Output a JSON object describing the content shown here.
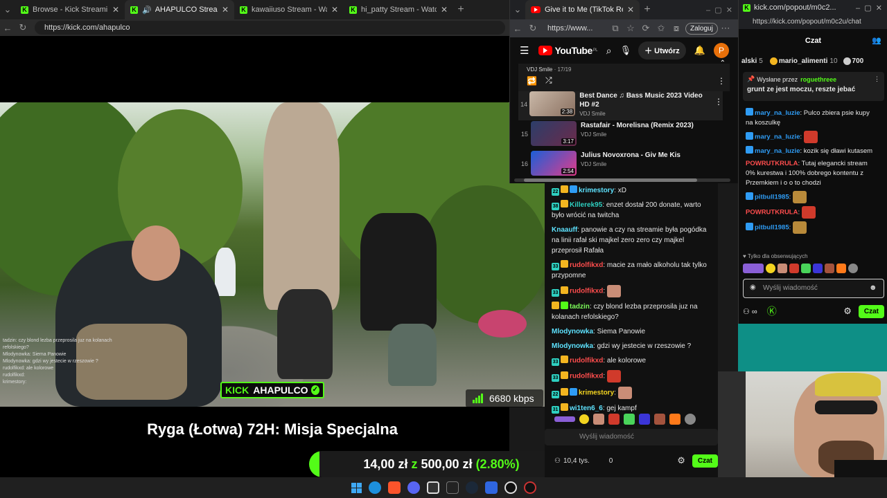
{
  "browser1": {
    "tabs": [
      {
        "label": "Browse - Kick Streaming",
        "active": false
      },
      {
        "label": "AHAPULCO Stream - Watch Li",
        "active": true
      },
      {
        "label": "kawaiiuso Stream - Watch Live on",
        "active": false
      },
      {
        "label": "hi_patty Stream - Watch Live on K",
        "active": false
      }
    ],
    "url": "https://kick.com/ahapulco"
  },
  "stream": {
    "logo_prefix": "KICK",
    "logo_name": "AHAPULCO",
    "bitrate": "6680 kbps",
    "title": "Ryga (Łotwa) 72H: Misja Specjalna",
    "goal_current": "14,00 zł",
    "goal_sep": "z",
    "goal_target": "500,00 zł",
    "goal_percent": "(2.80%)",
    "goal_fraction": 0.028,
    "overlay_chat": [
      "tadzin: czy blond lezba przeprosila juz na kolanach",
      "refolskiego?",
      "Mlodynowka: Siema Panowie",
      "Mlodynowka: gdzi wy jestecie w rzeszowie ?",
      "rudolfikxd: ale kolorowe",
      "rudolfikxd:",
      "krimestory:"
    ]
  },
  "kick_chat": {
    "messages": [
      {
        "badges": [
          "22",
          "crown",
          "mod"
        ],
        "user": "krimestory",
        "text": "xD",
        "color": "#5ee3ff"
      },
      {
        "badges": [
          "38",
          "crown"
        ],
        "user": "Killerek95",
        "text": "enzet dostał 200 donate, warto było wrócić na twitcha",
        "color": "#2ecfc0"
      },
      {
        "badges": [],
        "user": "Knaauff",
        "text": "panowie a czy na streamie była pogódka na linii rafał ski majkel zero zero czy majkel przeprosił Rafała",
        "color": "#5ee3ff"
      },
      {
        "badges": [
          "33",
          "crown"
        ],
        "user": "rudolfikxd",
        "text": "macie za mało alkoholu tak tylko przypomne",
        "color": "#ff4d4d"
      },
      {
        "badges": [
          "33",
          "crown"
        ],
        "user": "rudolfikxd",
        "text": "",
        "color": "#ff4d4d"
      },
      {
        "badges": [
          "crown",
          "green"
        ],
        "user": "tadzin",
        "text": "czy blond lezba przeprosila juz na kolanach refolskiego?",
        "color": "#7cfc5a"
      },
      {
        "badges": [],
        "user": "Mlodynowka",
        "text": "Siema Panowie",
        "color": "#5ee3ff"
      },
      {
        "badges": [],
        "user": "Mlodynowka",
        "text": "gdzi wy jestecie w rzeszowie ?",
        "color": "#5ee3ff"
      },
      {
        "badges": [
          "33",
          "crown"
        ],
        "user": "rudolfikxd",
        "text": "ale kolorowe",
        "color": "#ff4d4d"
      },
      {
        "badges": [
          "33",
          "crown"
        ],
        "user": "rudolfikxd",
        "text": "",
        "color": "#ff4d4d"
      },
      {
        "badges": [
          "22",
          "crown",
          "mod"
        ],
        "user": "krimestory",
        "text": "",
        "color": "#f3d420"
      },
      {
        "badges": [
          "31",
          "crown"
        ],
        "user": "wi1ten6_6",
        "text": "gej kampf",
        "color": "#5ee3ff"
      }
    ],
    "input_placeholder": "Wyślij wiadomość",
    "viewers": "10,4 tys.",
    "count": "0",
    "send_label": "Czat"
  },
  "browser2": {
    "tab_label": "Give it to Me (TikTok Remix) - You",
    "url": "https://www...",
    "login_label": "Zaloguj"
  },
  "youtube": {
    "logo": "YouTube",
    "logo_region": "PL",
    "create_label": "Utwórz",
    "avatar_letter": "P",
    "playlist_channel": "VDJ Smile",
    "playlist_pos": "17/19",
    "items": [
      {
        "num": "14",
        "title": "Best Dance ♫ Bass Music 2023 Video HD #2",
        "channel": "VDJ Smile",
        "duration": "2:38"
      },
      {
        "num": "15",
        "title": "Rastafair - Morelisna (Remix 2023)",
        "channel": "VDJ Smile",
        "duration": "3:17"
      },
      {
        "num": "16",
        "title": "Julius Novoxrona - Giv Me Kis",
        "channel": "VDJ Smile",
        "duration": "2:54"
      }
    ]
  },
  "popout": {
    "window_title": "kick.com/popout/m0c2...",
    "url": "https://kick.com/popout/m0c2u/chat",
    "header": "Czat",
    "leaderboard": [
      {
        "user": "alski",
        "count": "5"
      },
      {
        "user": "mario_alimenti",
        "count": "10"
      },
      {
        "user": "",
        "count": "700"
      }
    ],
    "pinned_by_label": "Wysłane przez",
    "pinned_by_user": "roguethreee",
    "pinned_text": "grunt ze jest moczu, reszte jebać",
    "messages": [
      {
        "user": "mary_na_luzie",
        "text": "Pulco zbiera psie kupy na koszulkę",
        "color": "#2f9cf4"
      },
      {
        "user": "mary_na_luzie",
        "text": "",
        "color": "#2f9cf4"
      },
      {
        "user": "mary_na_luzie",
        "text": "kozik się dławi kutasem",
        "color": "#2f9cf4"
      },
      {
        "user": "POWRUTKRULA",
        "text": "Tutaj elegancki stream 0% kurestwa i 100% dobrego kontentu z Przemkiem i o o to chodzi",
        "color": "#ff4d4d"
      },
      {
        "user": "pitbull1985",
        "text": "",
        "color": "#2f9cf4"
      },
      {
        "user": "POWRUTKRULA",
        "text": "",
        "color": "#ff4d4d"
      },
      {
        "user": "pitbull1985",
        "text": "",
        "color": "#2f9cf4"
      }
    ],
    "followers_only": "Tylko dla obserwujących",
    "input_placeholder": "Wyślij wiadomość",
    "send_label": "Czat"
  },
  "colors": {
    "kick_green": "#53fc18",
    "yt_red": "#ff0000"
  }
}
